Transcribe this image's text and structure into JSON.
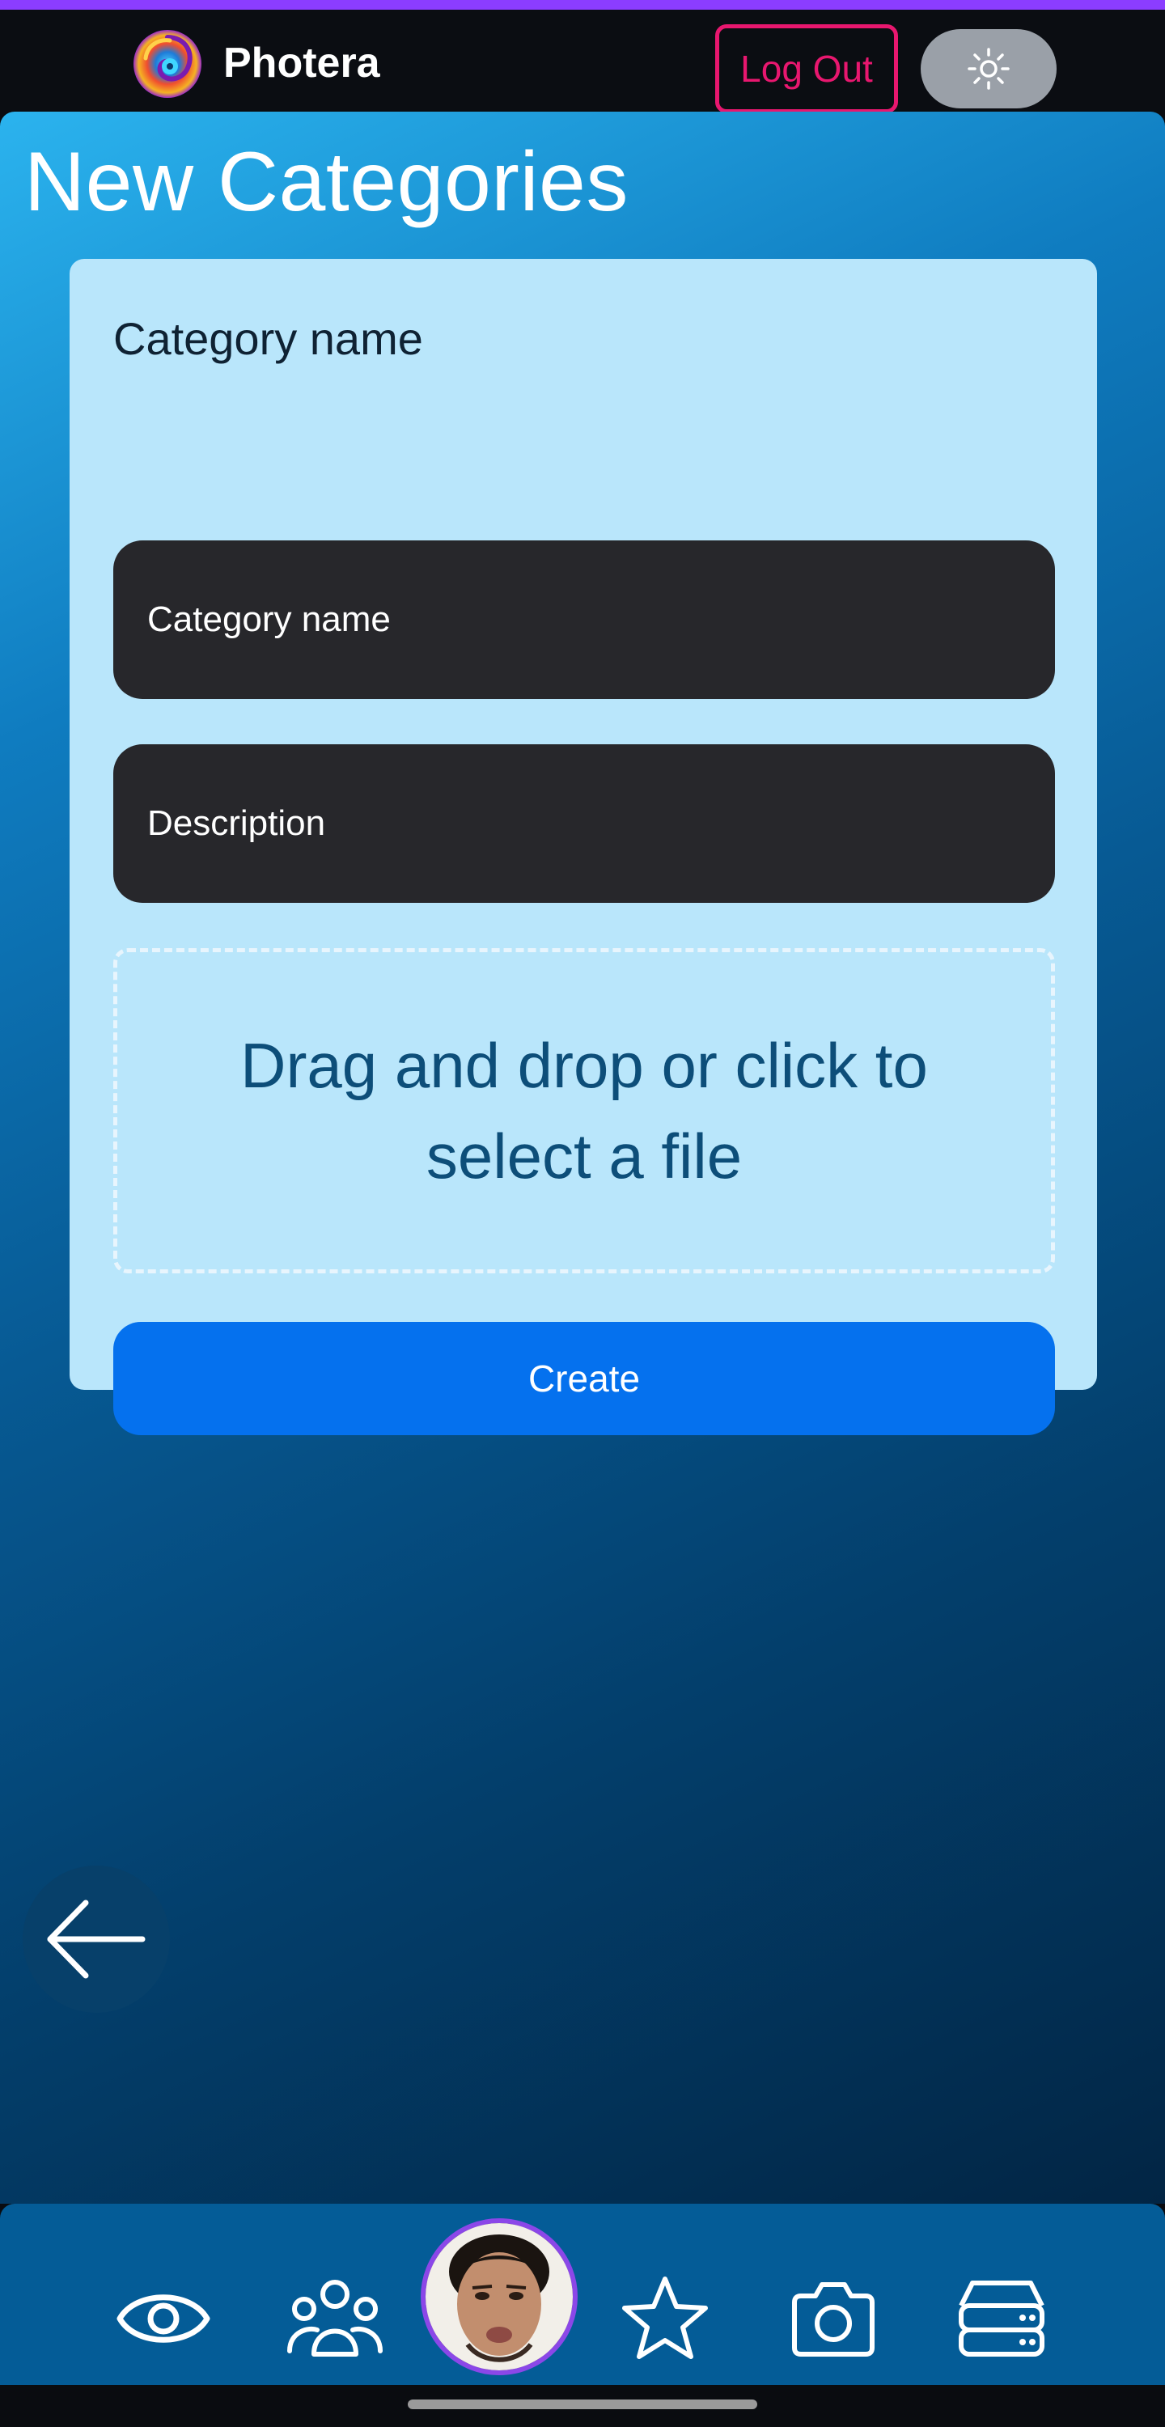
{
  "header": {
    "app_name": "Photera",
    "logout_label": "Log Out",
    "theme_toggle_icon": "sun-icon",
    "accent_color": "#e8176f",
    "top_bar_color": "#8b3dff"
  },
  "page": {
    "title": "New Categories"
  },
  "form": {
    "label": "Category name",
    "name_placeholder": "Category name",
    "description_placeholder": "Description",
    "dropzone_text": "Drag and drop or click to select a file",
    "create_label": "Create"
  },
  "navigation": {
    "back_icon": "arrow-left-icon",
    "items": [
      {
        "icon": "eye-icon"
      },
      {
        "icon": "users-icon"
      },
      {
        "icon": "avatar"
      },
      {
        "icon": "star-icon"
      },
      {
        "icon": "camera-icon"
      },
      {
        "icon": "server-icon"
      }
    ]
  }
}
